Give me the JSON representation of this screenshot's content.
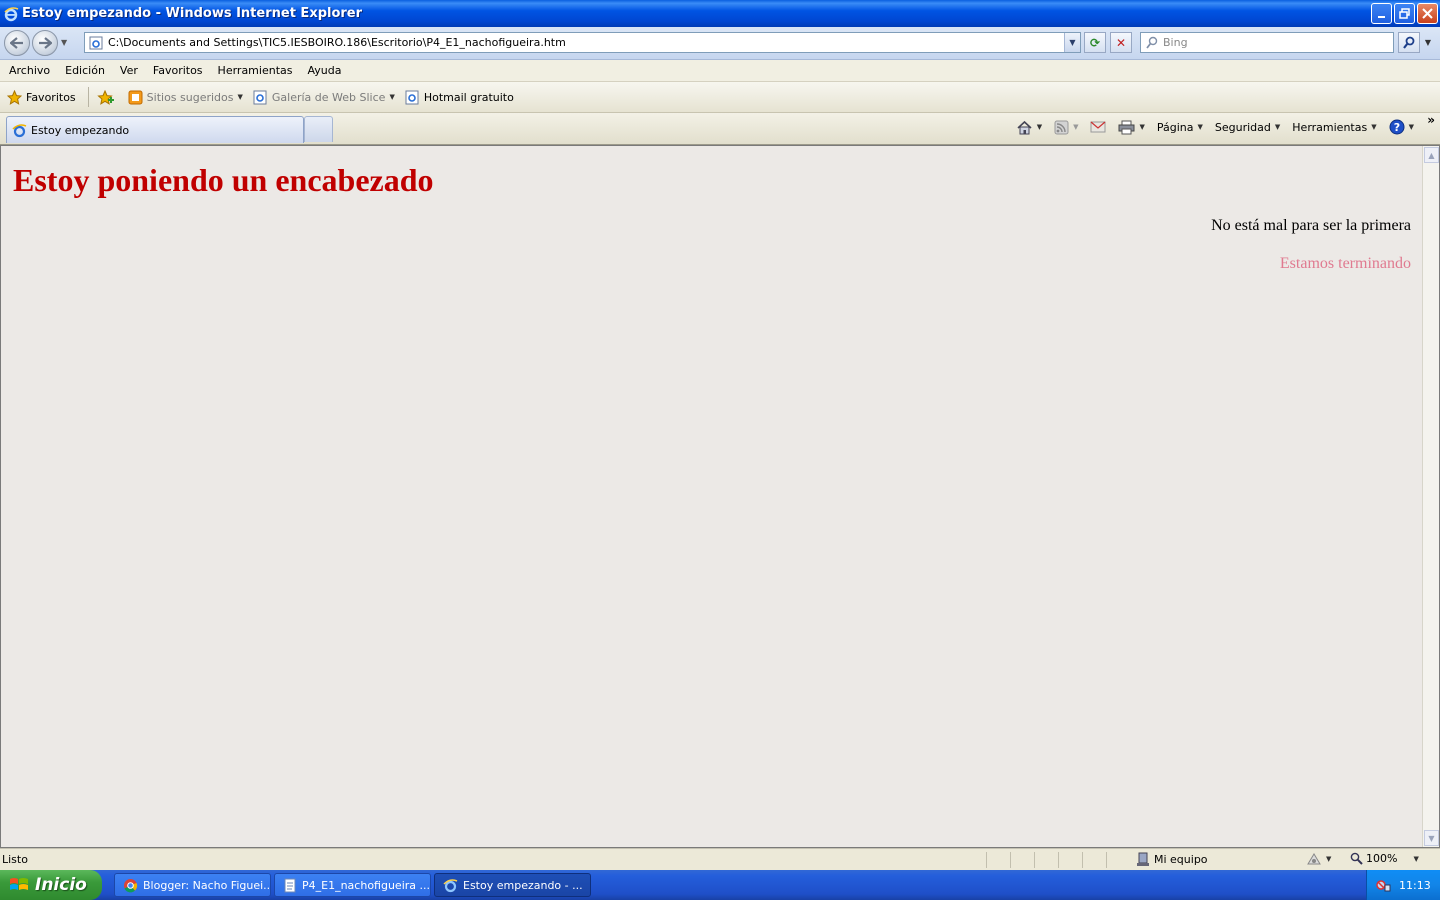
{
  "window": {
    "title": "Estoy empezando - Windows Internet Explorer",
    "controls": [
      "minimize",
      "restore",
      "close"
    ]
  },
  "address_bar": {
    "url": "C:\\Documents and Settings\\TIC5.IESBOIRO.186\\Escritorio\\P4_E1_nachofigueira.htm",
    "search_placeholder": "Bing"
  },
  "menu": [
    "Archivo",
    "Edición",
    "Ver",
    "Favoritos",
    "Herramientas",
    "Ayuda"
  ],
  "favorites_bar": {
    "favorites_label": "Favoritos",
    "items": [
      {
        "label": "Sitios sugeridos",
        "icon": "suggested-sites-icon"
      },
      {
        "label": "Galería de Web Slice",
        "icon": "web-slice-icon"
      },
      {
        "label": "Hotmail gratuito",
        "icon": "ie-page-icon"
      }
    ]
  },
  "tabs": [
    {
      "label": "Estoy empezando"
    }
  ],
  "command_bar": {
    "page": "Página",
    "security": "Seguridad",
    "tools": "Herramientas"
  },
  "content": {
    "heading": "Estoy poniendo un encabezado",
    "paragraph_1": "No está mal para ser la primera",
    "paragraph_2": "Estamos terminando",
    "colors": {
      "heading": "#c00000",
      "paragraph_2": "#e07a90"
    }
  },
  "status_bar": {
    "status": "Listo",
    "zone": "Mi equipo",
    "zoom": "100%"
  },
  "taskbar": {
    "start_label": "Inicio",
    "tasks": [
      {
        "label": "Blogger: Nacho Figuei...",
        "icon": "chrome-icon"
      },
      {
        "label": "P4_E1_nachofigueira ...",
        "icon": "notepad-icon"
      },
      {
        "label": "Estoy empezando - ...",
        "icon": "ie-icon"
      }
    ],
    "clock": "11:13"
  }
}
